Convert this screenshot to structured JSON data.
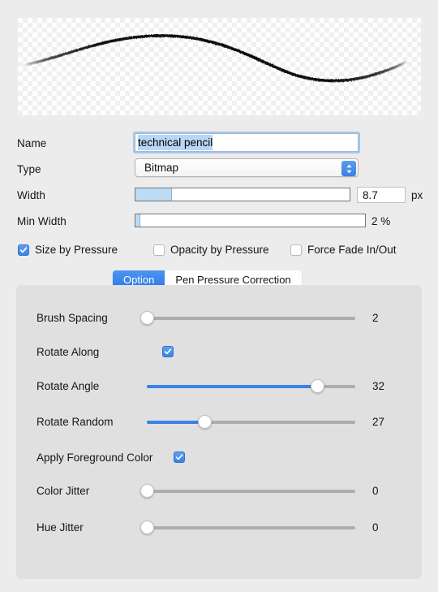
{
  "preview": {
    "name": "brush-stroke-preview",
    "stroke_color": "#0d0d0d",
    "background": "checkerboard-transparency"
  },
  "form": {
    "name": {
      "label": "Name",
      "value": "technical pencil",
      "selected": true
    },
    "type": {
      "label": "Type",
      "value": "Bitmap",
      "options": [
        "Bitmap"
      ]
    },
    "width": {
      "label": "Width",
      "fill_percent": 17,
      "value": "8.7",
      "unit": "px"
    },
    "min_width": {
      "label": "Min Width",
      "fill_percent": 2,
      "value": "2 %"
    }
  },
  "checkboxes": [
    {
      "label": "Size by Pressure",
      "checked": true
    },
    {
      "label": "Opacity by Pressure",
      "checked": false
    },
    {
      "label": "Force Fade In/Out",
      "checked": false
    }
  ],
  "tabs": [
    {
      "label": "Option",
      "active": true
    },
    {
      "label": "Pen Pressure Correction",
      "active": false
    }
  ],
  "options": [
    {
      "label": "Brush Spacing",
      "kind": "slider",
      "percent": 0,
      "value": "2"
    },
    {
      "label": "Rotate Along",
      "kind": "checkbox",
      "checked": true
    },
    {
      "label": "Rotate Angle",
      "kind": "slider",
      "percent": 82,
      "value": "32"
    },
    {
      "label": "Rotate Random",
      "kind": "slider",
      "percent": 28,
      "value": "27"
    },
    {
      "label": "Apply Foreground Color",
      "kind": "checkbox-inline",
      "checked": true
    },
    {
      "label": "Color Jitter",
      "kind": "slider",
      "percent": 0,
      "value": "0"
    },
    {
      "label": "Hue Jitter",
      "kind": "slider",
      "percent": 0,
      "value": "0"
    }
  ],
  "colors": {
    "accent": "#3c82e6",
    "window_bg": "#ececec",
    "panel_bg": "#e0e0e0",
    "selection": "#b8d6f5"
  }
}
